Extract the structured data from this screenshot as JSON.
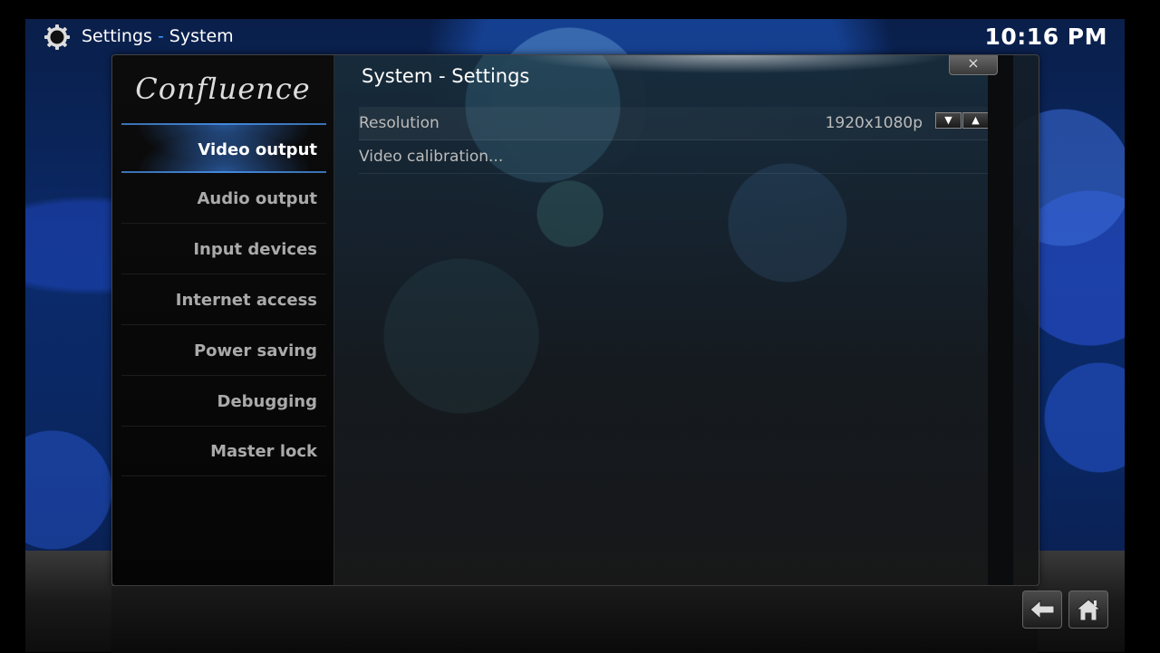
{
  "header": {
    "section": "Settings",
    "separator": "-",
    "subsection": "System",
    "clock": "10:16 PM",
    "icon": "gear-icon"
  },
  "sidebar": {
    "logo_text": "Confluence",
    "items": [
      {
        "label": "Video output",
        "active": true
      },
      {
        "label": "Audio output",
        "active": false
      },
      {
        "label": "Input devices",
        "active": false
      },
      {
        "label": "Internet access",
        "active": false
      },
      {
        "label": "Power saving",
        "active": false
      },
      {
        "label": "Debugging",
        "active": false
      },
      {
        "label": "Master lock",
        "active": false
      }
    ]
  },
  "content": {
    "title": "System - Settings",
    "close_label": "×",
    "settings": [
      {
        "label": "Resolution",
        "value": "1920x1080p",
        "spin_down": "▼",
        "spin_up": "▲"
      },
      {
        "label": "Video calibration..."
      }
    ]
  },
  "footer": {
    "back_icon": "back-arrow-icon",
    "home_icon": "home-icon"
  },
  "colors": {
    "accent": "#3e9cff",
    "text": "#ffffff",
    "muted_text": "#aaaaaa"
  }
}
